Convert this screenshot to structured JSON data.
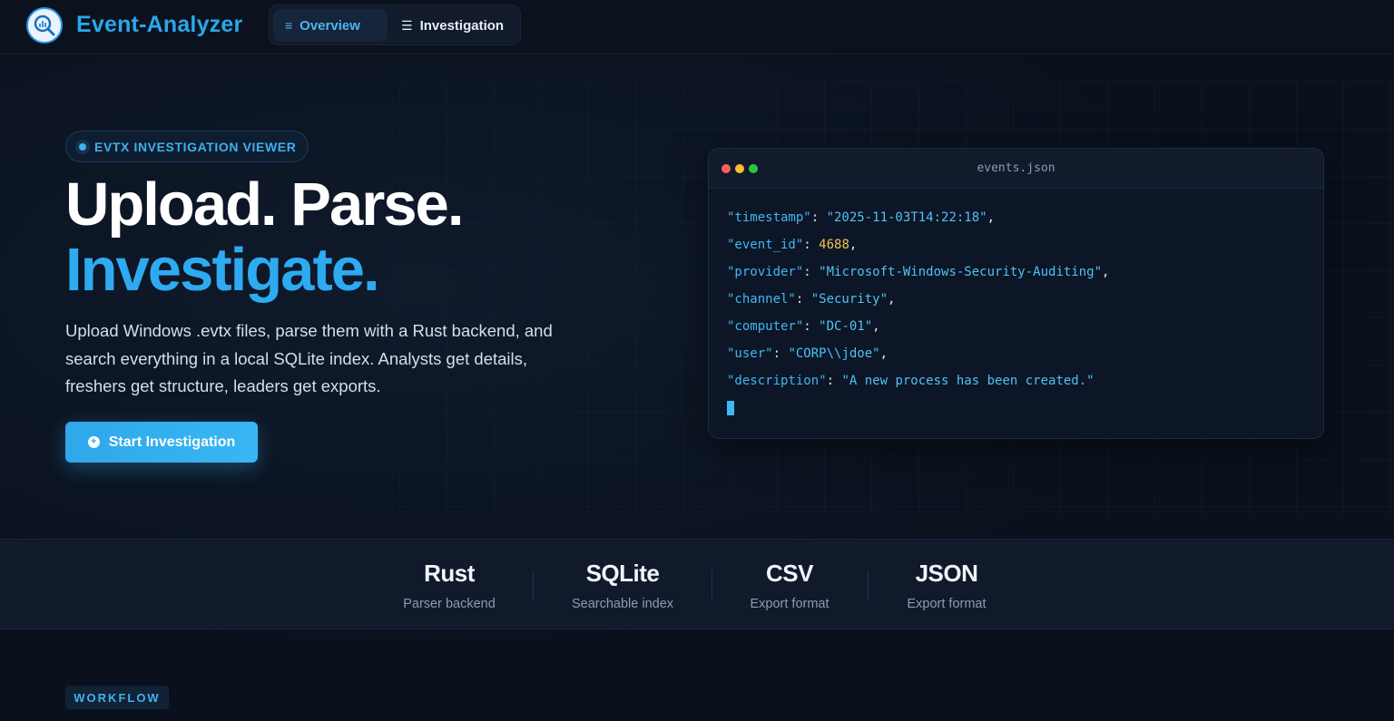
{
  "nav": {
    "brand": "Event-Analyzer",
    "tabs": [
      {
        "label": "Overview",
        "icon": "menu-icon",
        "active": true
      },
      {
        "label": "Investigation",
        "icon": "list-icon",
        "active": false
      }
    ]
  },
  "hero": {
    "badge": "EVTX INVESTIGATION VIEWER",
    "headline_line1": "Upload. Parse.",
    "headline_line2": "Investigate.",
    "lead": "Upload Windows .evtx files, parse them with a Rust backend, and search everything in a local SQLite index. Analysts get details, freshers get structure, leaders get exports.",
    "cta": "Start Investigation"
  },
  "code_window": {
    "filename": "events.json",
    "lines": [
      {
        "key": "\"timestamp\"",
        "value": "\"2025-11-03T14:22:18\"",
        "type": "string"
      },
      {
        "key": "\"event_id\"",
        "value": "4688",
        "type": "number"
      },
      {
        "key": "\"provider\"",
        "value": "\"Microsoft-Windows-Security-Auditing\"",
        "type": "string"
      },
      {
        "key": "\"channel\"",
        "value": "\"Security\"",
        "type": "string"
      },
      {
        "key": "\"computer\"",
        "value": "\"DC-01\"",
        "type": "string"
      },
      {
        "key": "\"user\"",
        "value": "\"CORP\\\\jdoe\"",
        "type": "string"
      },
      {
        "key": "\"description\"",
        "value": "\"A new process has been created.\"",
        "type": "string",
        "last": true
      }
    ]
  },
  "stats": [
    {
      "title": "Rust",
      "subtitle": "Parser backend"
    },
    {
      "title": "SQLite",
      "subtitle": "Searchable index"
    },
    {
      "title": "CSV",
      "subtitle": "Export format"
    },
    {
      "title": "JSON",
      "subtitle": "Export format"
    }
  ],
  "section_label": "WORKFLOW",
  "colors": {
    "accent": "#2eaaf0",
    "background": "#0a111d",
    "number": "#f2c14e"
  }
}
